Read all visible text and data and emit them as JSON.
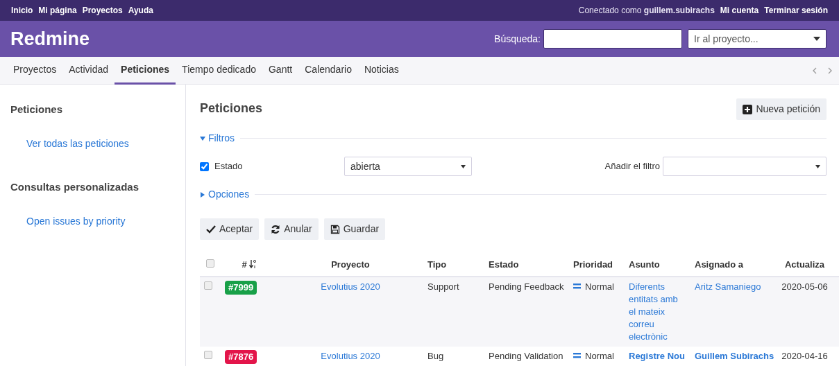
{
  "top_menu": {
    "left": [
      "Inicio",
      "Mi página",
      "Proyectos",
      "Ayuda"
    ],
    "logged_in_prefix": "Conectado como",
    "user": "guillem.subirachs",
    "right": [
      "Mi cuenta",
      "Terminar sesión"
    ]
  },
  "header": {
    "title": "Redmine",
    "search_label": "Búsqueda:",
    "project_jump": "Ir al proyecto..."
  },
  "tabs": [
    {
      "label": "Proyectos",
      "selected": false
    },
    {
      "label": "Actividad",
      "selected": false
    },
    {
      "label": "Peticiones",
      "selected": true
    },
    {
      "label": "Tiempo dedicado",
      "selected": false
    },
    {
      "label": "Gantt",
      "selected": false
    },
    {
      "label": "Calendario",
      "selected": false
    },
    {
      "label": "Noticias",
      "selected": false
    }
  ],
  "sidebar": {
    "sections": [
      {
        "title": "Peticiones",
        "links": [
          "Ver todas las peticiones"
        ]
      },
      {
        "title": "Consultas personalizadas",
        "links": [
          "Open issues by priority"
        ]
      }
    ]
  },
  "content": {
    "title": "Peticiones",
    "new_button": "Nueva petición",
    "filters": {
      "legend": "Filtros",
      "expanded": true,
      "rows": [
        {
          "label": "Estado",
          "checked": true,
          "operator": "abierta"
        }
      ],
      "add_label": "Añadir el filtro"
    },
    "options": {
      "legend": "Opciones",
      "expanded": false
    },
    "buttons": [
      {
        "kind": "apply",
        "label": "Aceptar"
      },
      {
        "kind": "clear",
        "label": "Anular"
      },
      {
        "kind": "save",
        "label": "Guardar"
      }
    ],
    "table": {
      "select_all_checked": false,
      "columns": [
        "#",
        "Proyecto",
        "Tipo",
        "Estado",
        "Prioridad",
        "Asunto",
        "Asignado a",
        "Actualiza"
      ],
      "rows": [
        {
          "selected": false,
          "bold": false,
          "id": "#7999",
          "color": "#18a048",
          "project": "Evolutius 2020",
          "tracker": "Support",
          "status": "Pending Feedback",
          "priority": "Normal",
          "subject": "Diferents entitats amb el mateix correu electrònic",
          "assignee": "Aritz Samaniego",
          "updated": "2020-05-06"
        },
        {
          "selected": false,
          "bold": true,
          "id": "#7876",
          "color": "#e3154a",
          "project": "Evolutius 2020",
          "tracker": "Bug",
          "status": "Pending Validation",
          "priority": "Normal",
          "subject": "Registre Nou",
          "assignee": "Guillem Subirachs",
          "updated": "2020-04-16"
        }
      ]
    }
  }
}
